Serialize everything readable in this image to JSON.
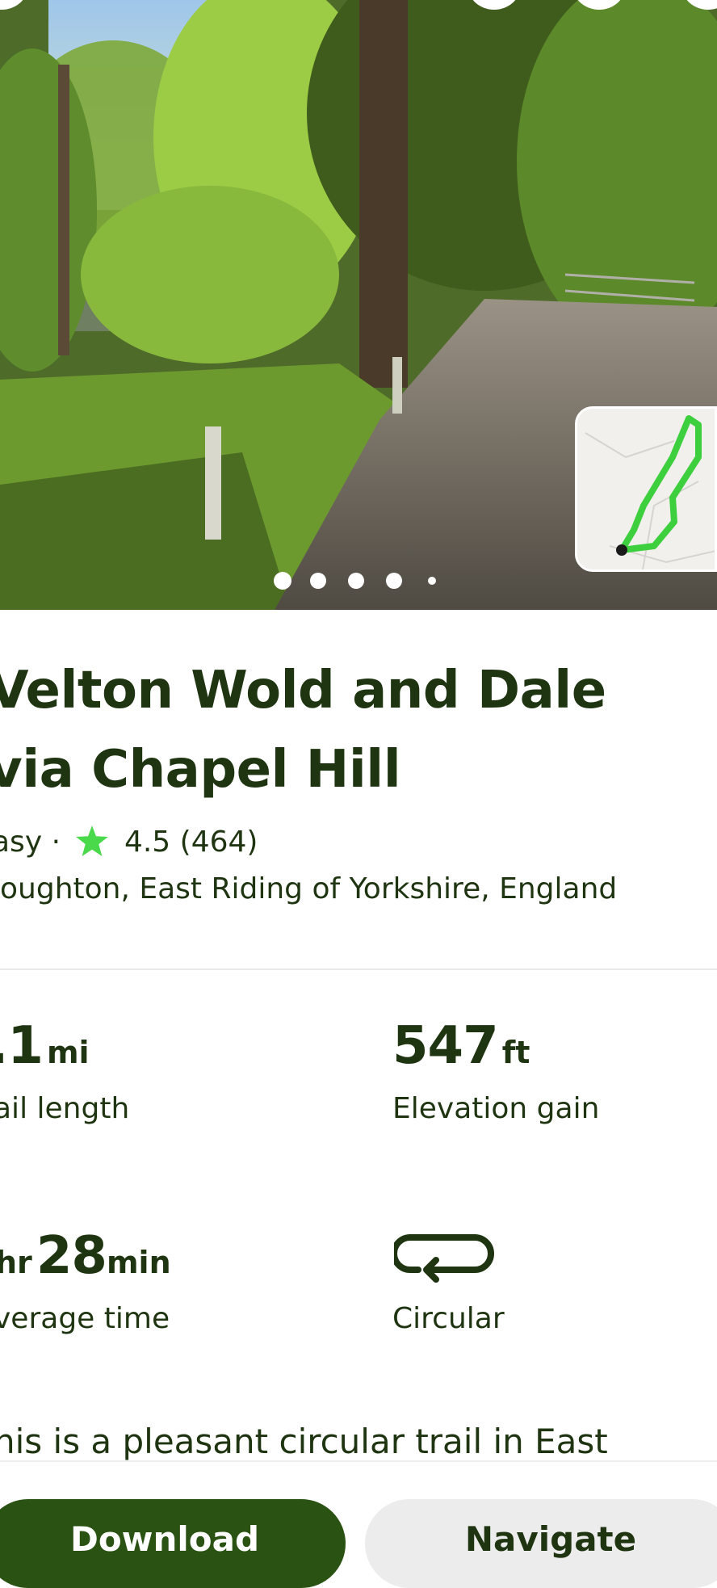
{
  "trail": {
    "title_line1": "Velton Wold and Dale",
    "title_line2": "via Chapel Hill",
    "difficulty": "asy",
    "separator": "·",
    "rating": "4.5",
    "review_count": "(464)",
    "location": "loughton, East Riding of Yorkshire, England"
  },
  "stats": {
    "length_value": ".1",
    "length_unit": "mi",
    "length_label": "ail length",
    "elevation_value": "547",
    "elevation_unit": "ft",
    "elevation_label": "Elevation gain",
    "time_hr_value": "",
    "time_hr_unit": "hr",
    "time_min_value": "28",
    "time_min_unit": "min",
    "time_label": "verage time",
    "route_type_label": "Circular"
  },
  "description": "his is a pleasant circular trail in East",
  "actions": {
    "download_label": "Download",
    "navigate_label": "Navigate"
  },
  "colors": {
    "primary": "#2a5212",
    "text": "#1f3511",
    "rating_star": "#4ad94a",
    "route_line": "#3ecf3e"
  },
  "carousel": {
    "total_dots": 5,
    "active_index": 0
  }
}
